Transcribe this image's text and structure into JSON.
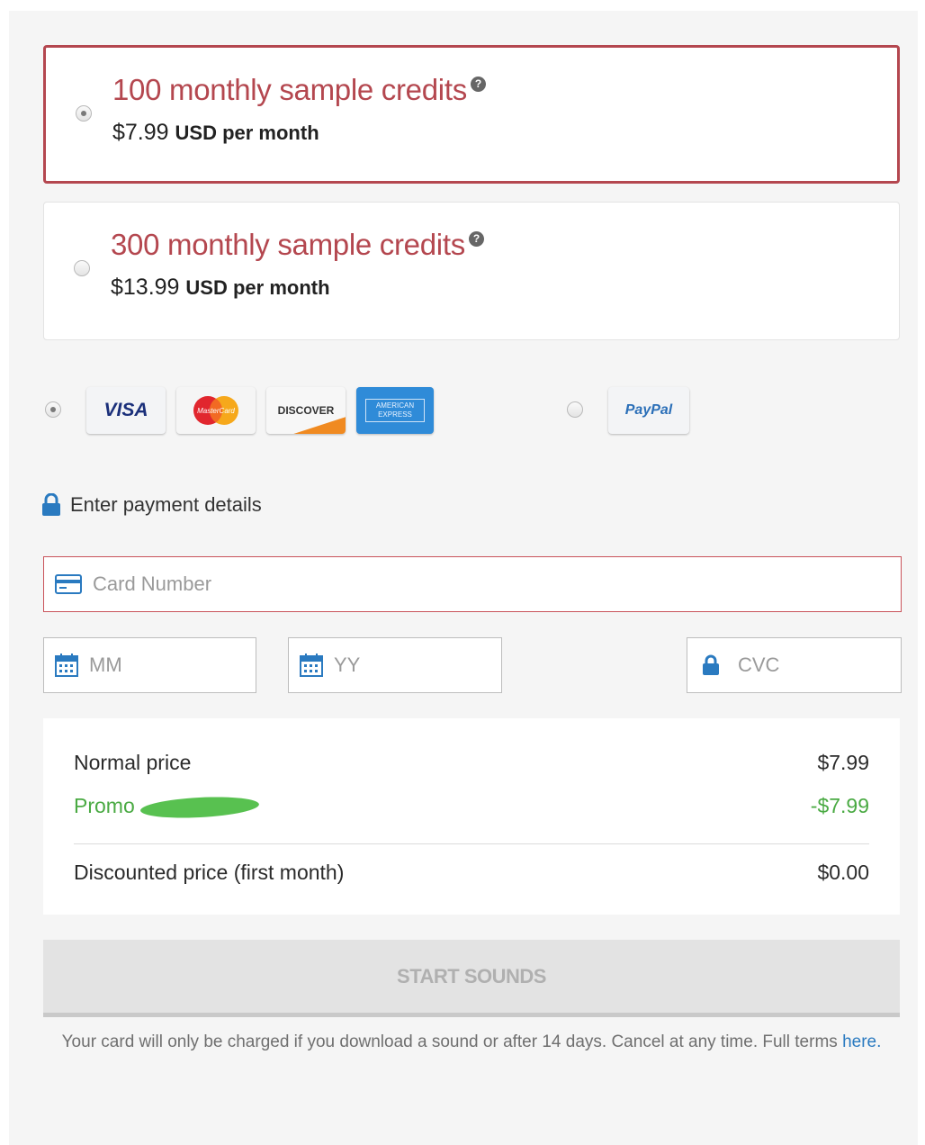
{
  "plans": [
    {
      "title": "100 monthly sample credits",
      "price": "$7.99",
      "price_suffix": "USD per month",
      "help_icon": "question-icon",
      "selected": true
    },
    {
      "title": "300 monthly sample credits",
      "price": "$13.99",
      "price_suffix": "USD per month",
      "help_icon": "question-icon",
      "selected": false
    }
  ],
  "payment_methods": {
    "cards": [
      "VISA",
      "MasterCard",
      "DISCOVER",
      "AMERICAN EXPRESS"
    ],
    "card_selected": true,
    "paypal": "PayPal",
    "paypal_selected": false
  },
  "payment_details": {
    "heading": "Enter payment details",
    "card_number_placeholder": "Card Number",
    "month_placeholder": "MM",
    "year_placeholder": "YY",
    "cvc_placeholder": "CVC"
  },
  "summary": {
    "normal_price_label": "Normal price",
    "normal_price_value": "$7.99",
    "promo_label": "Promo",
    "promo_value": "-$7.99",
    "discounted_label": "Discounted price (first month)",
    "discounted_value": "$0.00"
  },
  "submit": {
    "label": "START SOUNDS"
  },
  "footnote": {
    "text": "Your card will only be charged if you download a sound or after 14 days. Cancel at any time. Full terms ",
    "link": "here."
  },
  "colors": {
    "accent": "#b4474f",
    "promo": "#4aaa43",
    "link": "#2a7ac0",
    "button_bg": "#e3e3e3"
  }
}
